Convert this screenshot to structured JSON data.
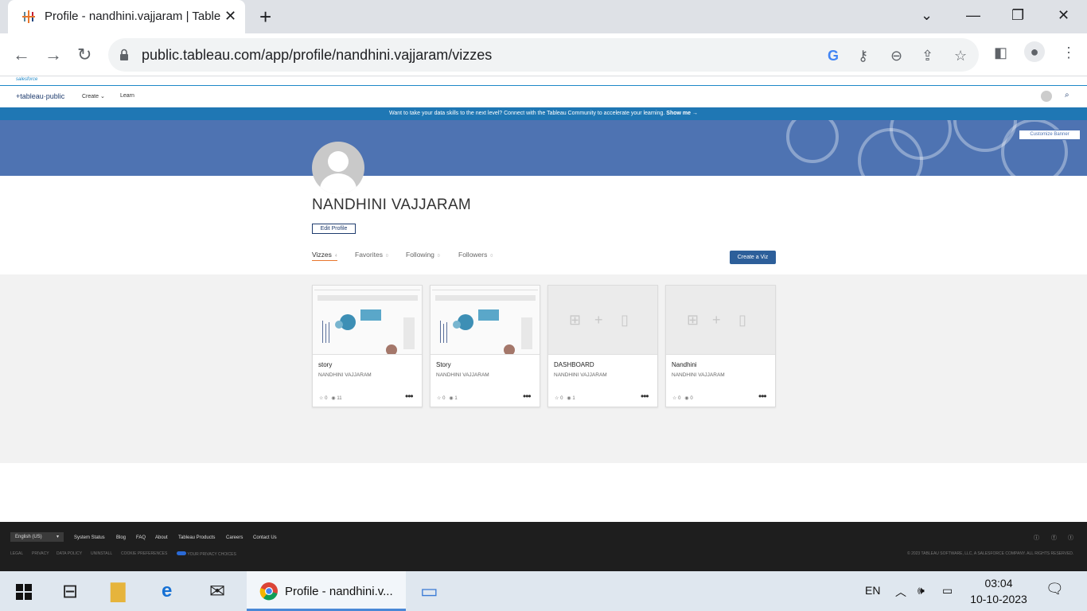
{
  "browser": {
    "tab_title": "Profile - nandhini.vajjaram | Table",
    "url": "public.tableau.com/app/profile/nandhini.vajjaram/vizzes",
    "new_tab": "+",
    "close": "✕"
  },
  "tableau": {
    "salesforce_label": "salesforce",
    "logo": "+tableau·public",
    "nav": {
      "create": "Create",
      "learn": "Learn"
    },
    "announcement": "Want to take your data skills to the next level? Connect with the Tableau Community to accelerate your learning.",
    "announcement_link": "Show me →",
    "customize_banner": "Customize Banner"
  },
  "profile": {
    "name": "NANDHINI VAJJARAM",
    "edit_label": "Edit Profile",
    "tabs": [
      {
        "label": "Vizzes",
        "count": "4"
      },
      {
        "label": "Favorites",
        "count": "0"
      },
      {
        "label": "Following",
        "count": "0"
      },
      {
        "label": "Followers",
        "count": "0"
      }
    ],
    "create_viz": "Create a Viz"
  },
  "cards": [
    {
      "title": "story",
      "author": "NANDHINI VAJJARAM",
      "favorites": "0",
      "views": "11"
    },
    {
      "title": "Story",
      "author": "NANDHINI VAJJARAM",
      "favorites": "0",
      "views": "1"
    },
    {
      "title": "DASHBOARD",
      "author": "NANDHINI VAJJARAM",
      "favorites": "0",
      "views": "1"
    },
    {
      "title": "Nandhini",
      "author": "NANDHINI VAJJARAM",
      "favorites": "0",
      "views": "0"
    }
  ],
  "footer": {
    "language": "English (US)",
    "links": [
      "System Status",
      "Blog",
      "FAQ",
      "About",
      "Tableau Products",
      "Careers",
      "Contact Us"
    ],
    "legal": [
      "LEGAL",
      "PRIVACY",
      "DATA POLICY",
      "UNINSTALL",
      "COOKIE PREFERENCES",
      "YOUR PRIVACY CHOICES"
    ],
    "copyright": "© 2023 TABLEAU SOFTWARE, LLC, A SALESFORCE COMPANY. ALL RIGHTS RESERVED."
  },
  "taskbar": {
    "chrome_label": "Profile - nandhini.v...",
    "lang": "EN",
    "time": "03:04",
    "date": "10-10-2023"
  },
  "colors": {
    "tableau_blue": "#1f77b4",
    "banner": "#4e73b2",
    "create_button": "#2d5f9a",
    "active_tab_underline": "#e8762d"
  }
}
